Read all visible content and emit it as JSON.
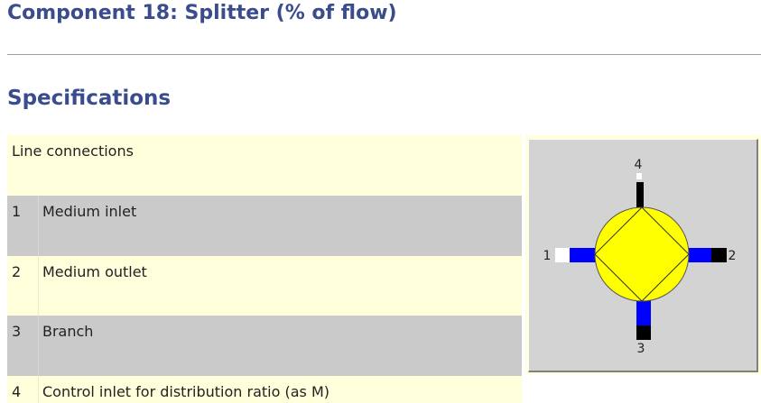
{
  "page": {
    "title": "Component 18: Splitter (% of flow)",
    "section": "Specifications"
  },
  "table": {
    "header": "Line connections",
    "rows": [
      {
        "num": "1",
        "label": "Medium inlet"
      },
      {
        "num": "2",
        "label": "Medium outlet"
      },
      {
        "num": "3",
        "label": "Branch"
      },
      {
        "num": "4",
        "label": "Control inlet for distribution ratio (as M)"
      }
    ]
  },
  "diagram": {
    "port_labels": [
      "1",
      "2",
      "3",
      "4"
    ],
    "colors": {
      "body": "#ffff00",
      "pipe": "#0000ff",
      "port_white": "#ffffff",
      "port_black": "#000000",
      "background": "#d3d3d3"
    }
  }
}
